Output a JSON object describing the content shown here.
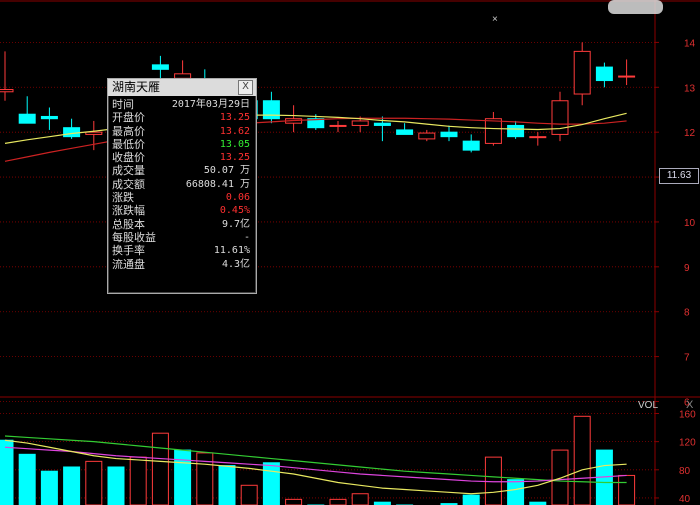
{
  "chart_data": [
    {
      "type": "candlestick",
      "title": "",
      "y_ticks": [
        6,
        7,
        8,
        9,
        10,
        11,
        12,
        13,
        14
      ],
      "ylim": [
        6.1,
        14.9
      ],
      "last_price_label": "11.63",
      "candles": [
        {
          "o": 12.9,
          "h": 13.8,
          "l": 12.7,
          "c": 12.95
        },
        {
          "o": 12.4,
          "h": 12.8,
          "l": 12.2,
          "c": 12.2
        },
        {
          "o": 12.35,
          "h": 12.55,
          "l": 12.05,
          "c": 12.3
        },
        {
          "o": 12.1,
          "h": 12.3,
          "l": 11.85,
          "c": 11.9
        },
        {
          "o": 11.95,
          "h": 12.25,
          "l": 11.6,
          "c": 12.0
        },
        {
          "o": 12.3,
          "h": 12.5,
          "l": 12.0,
          "c": 12.2
        },
        {
          "o": 12.5,
          "h": 13.05,
          "l": 12.25,
          "c": 12.9
        },
        {
          "o": 13.5,
          "h": 13.7,
          "l": 13.1,
          "c": 13.4
        },
        {
          "o": 13.2,
          "h": 13.6,
          "l": 12.9,
          "c": 13.3
        },
        {
          "o": 13.1,
          "h": 13.4,
          "l": 12.6,
          "c": 12.8
        },
        {
          "o": 13.0,
          "h": 13.2,
          "l": 12.7,
          "c": 12.8
        },
        {
          "o": 12.7,
          "h": 12.95,
          "l": 12.2,
          "c": 12.3
        },
        {
          "o": 12.7,
          "h": 12.9,
          "l": 12.2,
          "c": 12.3
        },
        {
          "o": 12.2,
          "h": 12.6,
          "l": 12.0,
          "c": 12.3
        },
        {
          "o": 12.3,
          "h": 12.4,
          "l": 12.05,
          "c": 12.1
        },
        {
          "o": 12.15,
          "h": 12.25,
          "l": 12.0,
          "c": 12.15
        },
        {
          "o": 12.15,
          "h": 12.35,
          "l": 12.0,
          "c": 12.25
        },
        {
          "o": 12.2,
          "h": 12.35,
          "l": 11.8,
          "c": 12.15
        },
        {
          "o": 12.05,
          "h": 12.2,
          "l": 11.95,
          "c": 11.95
        },
        {
          "o": 11.85,
          "h": 12.05,
          "l": 11.8,
          "c": 11.98
        },
        {
          "o": 12.0,
          "h": 12.15,
          "l": 11.8,
          "c": 11.9
        },
        {
          "o": 11.8,
          "h": 11.95,
          "l": 11.55,
          "c": 11.6
        },
        {
          "o": 11.75,
          "h": 12.45,
          "l": 11.7,
          "c": 12.3
        },
        {
          "o": 12.15,
          "h": 12.25,
          "l": 11.85,
          "c": 11.9
        },
        {
          "o": 11.9,
          "h": 12.0,
          "l": 11.7,
          "c": 11.9
        },
        {
          "o": 11.95,
          "h": 12.9,
          "l": 11.8,
          "c": 12.7
        },
        {
          "o": 12.85,
          "h": 14.0,
          "l": 12.6,
          "c": 13.8
        },
        {
          "o": 13.45,
          "h": 13.55,
          "l": 13.0,
          "c": 13.15
        },
        {
          "o": 13.25,
          "h": 13.62,
          "l": 13.05,
          "c": 13.25
        }
      ],
      "ma_yellow": [
        11.75,
        11.83,
        11.9,
        11.97,
        12.02,
        12.08,
        12.14,
        12.2,
        12.27,
        12.32,
        12.36,
        12.38,
        12.38,
        12.37,
        12.35,
        12.33,
        12.3,
        12.26,
        12.23,
        12.18,
        12.13,
        12.1,
        12.08,
        12.07,
        12.06,
        12.08,
        12.17,
        12.3,
        12.42
      ],
      "ma_red": [
        11.35,
        11.45,
        11.55,
        11.64,
        11.73,
        11.82,
        11.9,
        11.98,
        12.05,
        12.11,
        12.16,
        12.2,
        12.23,
        12.26,
        12.28,
        12.3,
        12.31,
        12.31,
        12.31,
        12.3,
        12.29,
        12.27,
        12.25,
        12.23,
        12.2,
        12.18,
        12.18,
        12.2,
        12.25
      ]
    },
    {
      "type": "bar",
      "title": "",
      "series_label": "VOL",
      "y_ticks": [
        40,
        80,
        120,
        160
      ],
      "ylim": [
        30,
        182
      ],
      "bars": [
        {
          "v": 122,
          "up": false
        },
        {
          "v": 102,
          "up": false
        },
        {
          "v": 78,
          "up": false
        },
        {
          "v": 84,
          "up": false
        },
        {
          "v": 92,
          "up": true
        },
        {
          "v": 84,
          "up": false
        },
        {
          "v": 98,
          "up": true
        },
        {
          "v": 132,
          "up": true
        },
        {
          "v": 108,
          "up": false
        },
        {
          "v": 104,
          "up": true
        },
        {
          "v": 86,
          "up": false
        },
        {
          "v": 58,
          "up": true
        },
        {
          "v": 90,
          "up": false
        },
        {
          "v": 38,
          "up": true
        },
        {
          "v": 30,
          "up": false
        },
        {
          "v": 38,
          "up": true
        },
        {
          "v": 46,
          "up": true
        },
        {
          "v": 34,
          "up": false
        },
        {
          "v": 30,
          "up": false
        },
        {
          "v": 28,
          "up": true
        },
        {
          "v": 32,
          "up": false
        },
        {
          "v": 44,
          "up": false
        },
        {
          "v": 98,
          "up": true
        },
        {
          "v": 66,
          "up": false
        },
        {
          "v": 34,
          "up": false
        },
        {
          "v": 108,
          "up": true
        },
        {
          "v": 156,
          "up": true
        },
        {
          "v": 108,
          "up": false
        },
        {
          "v": 72,
          "up": true
        }
      ],
      "ma_yellow": [
        122,
        118,
        112,
        106,
        100,
        96,
        94,
        92,
        90,
        88,
        85,
        82,
        78,
        74,
        68,
        62,
        58,
        54,
        52,
        50,
        48,
        46,
        48,
        52,
        58,
        68,
        80,
        86,
        88
      ],
      "ma_magenta": [
        112,
        110,
        108,
        106,
        103,
        100,
        98,
        96,
        94,
        92,
        90,
        88,
        86,
        83,
        80,
        77,
        74,
        72,
        70,
        68,
        66,
        64,
        63,
        63,
        64,
        66,
        68,
        70,
        72
      ],
      "ma_green": [
        128,
        126,
        124,
        122,
        120,
        117,
        114,
        111,
        108,
        105,
        102,
        99,
        96,
        93,
        90,
        87,
        84,
        81,
        78,
        76,
        74,
        72,
        70,
        68,
        66,
        64,
        63,
        62,
        62
      ]
    }
  ],
  "info_panel": {
    "title": "湖南天雁",
    "close": "X",
    "rows": [
      {
        "label": "时间",
        "value": "2017年03月29日",
        "color": "#dddddd"
      },
      {
        "label": "开盘价",
        "value": "13.25",
        "color": "#ff3030"
      },
      {
        "label": "最高价",
        "value": "13.62",
        "color": "#ff3030"
      },
      {
        "label": "最低价",
        "value": "13.05",
        "color": "#33ee33"
      },
      {
        "label": "收盘价",
        "value": "13.25",
        "color": "#ff3030"
      },
      {
        "label": "成交量",
        "value": "50.07 万",
        "color": "#dddddd"
      },
      {
        "label": "成交额",
        "value": "66808.41 万",
        "color": "#dddddd"
      },
      {
        "label": "涨跌",
        "value": "0.06",
        "color": "#ff3030"
      },
      {
        "label": "涨跌幅",
        "value": "0.45%",
        "color": "#ff3030"
      },
      {
        "label": "总股本",
        "value": "9.7亿",
        "color": "#dddddd"
      },
      {
        "label": "每股收益",
        "value": "-",
        "color": "#dddddd"
      },
      {
        "label": "换手率",
        "value": "11.61%",
        "color": "#dddddd"
      },
      {
        "label": "流通盘",
        "value": "4.3亿",
        "color": "#dddddd"
      }
    ]
  },
  "vol_close": "X",
  "top_marker": "×",
  "colors": {
    "up": "#ff3b3b",
    "down": "#00ffff",
    "grid": "#8b0000",
    "axis_text": "#e03030",
    "ma_yellow": "#e8e860",
    "ma_red": "#cc2222",
    "ma_magenta": "#dd44dd",
    "ma_green": "#33cc33"
  }
}
